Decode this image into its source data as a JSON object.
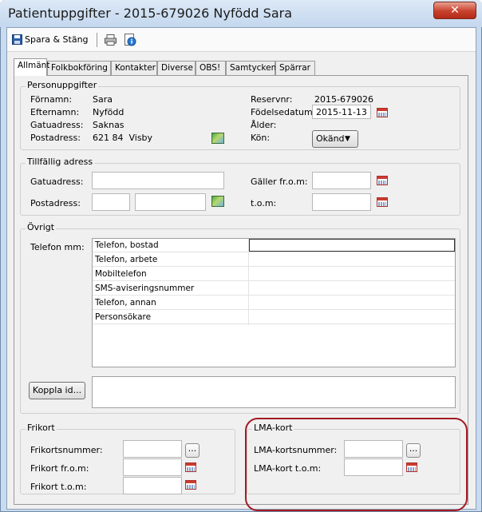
{
  "window": {
    "title": "Patientuppgifter - 2015-679026 Nyfödd Sara",
    "close_glyph": "✕"
  },
  "toolbar": {
    "save_close_label": "Spara & Stäng",
    "save_icon": "floppy-disk-icon",
    "print_icon": "printer-icon",
    "info_icon": "info-icon"
  },
  "tabs": [
    {
      "label": "Allmänt",
      "active": true
    },
    {
      "label": "Folkbokföring"
    },
    {
      "label": "Kontakter"
    },
    {
      "label": "Diverse"
    },
    {
      "label": "OBS!"
    },
    {
      "label": "Samtycken"
    },
    {
      "label": "Spärrar"
    }
  ],
  "personuppgifter": {
    "legend": "Personuppgifter",
    "fornamn_label": "Förnamn:",
    "fornamn": "Sara",
    "efternamn_label": "Efternamn:",
    "efternamn": "Nyfödd",
    "gatuadress_label": "Gatuadress:",
    "gatuadress": "Saknas",
    "postadress_label": "Postadress:",
    "postadress": "621 84  Visby",
    "reservnr_label": "Reservnr:",
    "reservnr": "2015-679026",
    "fodelsedatum_label": "Födelsedatum:",
    "fodelsedatum": "2015-11-13",
    "alder_label": "Ålder:",
    "alder": "",
    "kon_label": "Kön:",
    "kon": "Okänd",
    "dropdown_glyph": "▼"
  },
  "tillfallig": {
    "legend": "Tillfällig adress",
    "gatuadress_label": "Gatuadress:",
    "postadress_label": "Postadress:",
    "galler_label": "Gäller fr.o.m:",
    "tom_label": "t.o.m:"
  },
  "ovrigt": {
    "legend": "Övrigt",
    "telefon_label": "Telefon mm:",
    "phone_rows": [
      "Telefon, bostad",
      "Telefon, arbete",
      "Mobiltelefon",
      "SMS-aviseringsnummer",
      "Telefon, annan",
      "Personsökare"
    ],
    "koppla_label": "Koppla id..."
  },
  "frikort": {
    "legend": "Frikort",
    "nummer_label": "Frikortsnummer:",
    "from_label": "Frikort fr.o.m:",
    "tom_label": "Frikort t.o.m:",
    "ellipsis": "..."
  },
  "lma": {
    "legend": "LMA-kort",
    "nummer_label": "LMA-kortsnummer:",
    "tom_label": "LMA-kort t.o.m:",
    "ellipsis": "..."
  },
  "colors": {
    "highlight": "#a31a24",
    "close_button": "#c7412c"
  }
}
